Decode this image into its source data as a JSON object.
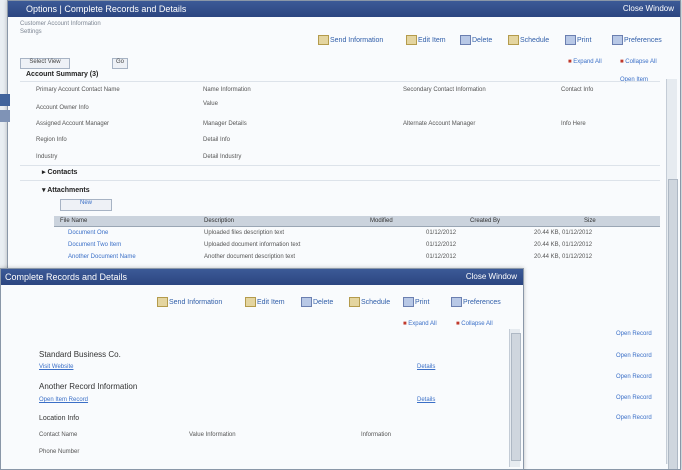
{
  "back_window": {
    "title": "Options   |   Complete Records and Details",
    "title_right": "Close Window",
    "header_lines": [
      "Customer Account Information",
      "Settings"
    ],
    "toolbar": [
      {
        "label": "Send Information",
        "style": "gold"
      },
      {
        "label": "Edit Item",
        "style": "gold"
      },
      {
        "label": "Delete",
        "style": "blue"
      },
      {
        "label": "Schedule",
        "style": "gold"
      },
      {
        "label": "Print",
        "style": "blue"
      },
      {
        "label": "Preferences",
        "style": "blue"
      }
    ],
    "view_select": "Select View",
    "go_label": "Go",
    "right_links": [
      "Expand All",
      "Collapse All"
    ],
    "right_link2": "Open Item",
    "section_title": "Account Summary (3)",
    "fields": [
      {
        "label": "Primary Account Contact Name",
        "value": "Name Information",
        "label2": "Secondary Contact Information",
        "value2": "Contact Info"
      },
      {
        "label": "Account Owner Info",
        "value": "Value",
        "label2": "",
        "value2": ""
      },
      {
        "label": "Assigned Account Manager",
        "value": "Manager Details",
        "label2": "Alternate Account Manager",
        "value2": "Info Here"
      },
      {
        "label": "Region Info",
        "value": "Detail Info",
        "label2": "",
        "value2": ""
      },
      {
        "label": "Industry",
        "value": "Detail Industry",
        "label2": "",
        "value2": ""
      }
    ],
    "subsection1": "Contacts",
    "subsection2": "Attachments",
    "new_button": "New",
    "table_headers": [
      "File Name",
      "Description",
      "Modified",
      "Created By",
      "Size"
    ],
    "table_rows": [
      {
        "name": "Document One",
        "desc": "Uploaded files description text",
        "mod": "01/12/2012",
        "size": "20.44 KB, 01/12/2012"
      },
      {
        "name": "Document Two Item",
        "desc": "Uploaded document information text",
        "mod": "01/12/2012",
        "size": "20.44 KB, 01/12/2012"
      },
      {
        "name": "Another Document Name",
        "desc": "Another document description text",
        "mod": "01/12/2012",
        "size": "20.44 KB, 01/12/2012"
      }
    ],
    "side_links": [
      "Open Record",
      "Open Record",
      "Open Record",
      "Open Record",
      "Open Record"
    ]
  },
  "front_window": {
    "title": "Complete Records and Details",
    "title_right": "Close Window",
    "toolbar": [
      {
        "label": "Send Information",
        "style": "gold"
      },
      {
        "label": "Edit Item",
        "style": "gold"
      },
      {
        "label": "Delete",
        "style": "blue"
      },
      {
        "label": "Schedule",
        "style": "gold"
      },
      {
        "label": "Print",
        "style": "blue"
      },
      {
        "label": "Preferences",
        "style": "blue"
      }
    ],
    "right_links": [
      "Expand All",
      "Collapse All"
    ],
    "items": [
      {
        "title": "Standard Business Co.",
        "link": "Visit Website",
        "right": "Details"
      },
      {
        "title": "Another Record Information",
        "link": "Open Item Record",
        "right": "Details"
      },
      {
        "title": "Location Info",
        "link": "",
        "right": ""
      }
    ],
    "bottom_fields": [
      {
        "label": "Contact Name",
        "value": "Value Information",
        "value2": "Information"
      },
      {
        "label": "Phone Number",
        "value": "",
        "value2": ""
      }
    ]
  }
}
